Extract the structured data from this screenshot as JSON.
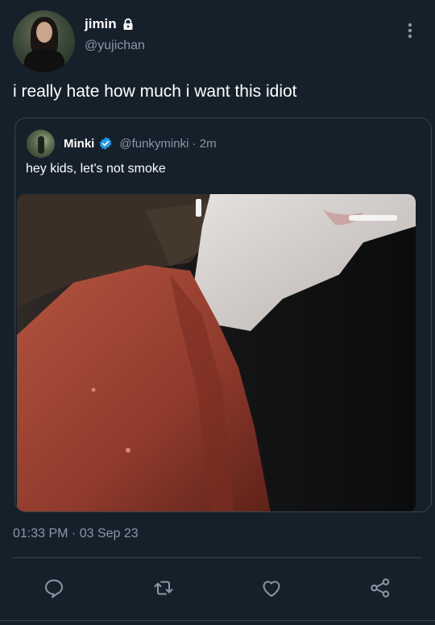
{
  "author": {
    "name": "jimin",
    "handle": "@yujichan"
  },
  "tweet": {
    "text": "i really hate how much i want this idiot",
    "timestamp": "01:33 PM · 03 Sep 23"
  },
  "quoted": {
    "name": "Minki",
    "handle_time": "@funkyminki · 2m",
    "text": "hey kids, let's not smoke"
  },
  "icons": {
    "lock": "lock-icon",
    "more": "more-vertical-icon",
    "verified": "verified-badge-icon",
    "reply": "reply-icon",
    "retweet": "retweet-icon",
    "like": "heart-icon",
    "share": "share-icon"
  },
  "colors": {
    "background": "#15202b",
    "secondary_text": "#8899a6",
    "border": "#38444d",
    "verified": "#1d9bf0"
  }
}
